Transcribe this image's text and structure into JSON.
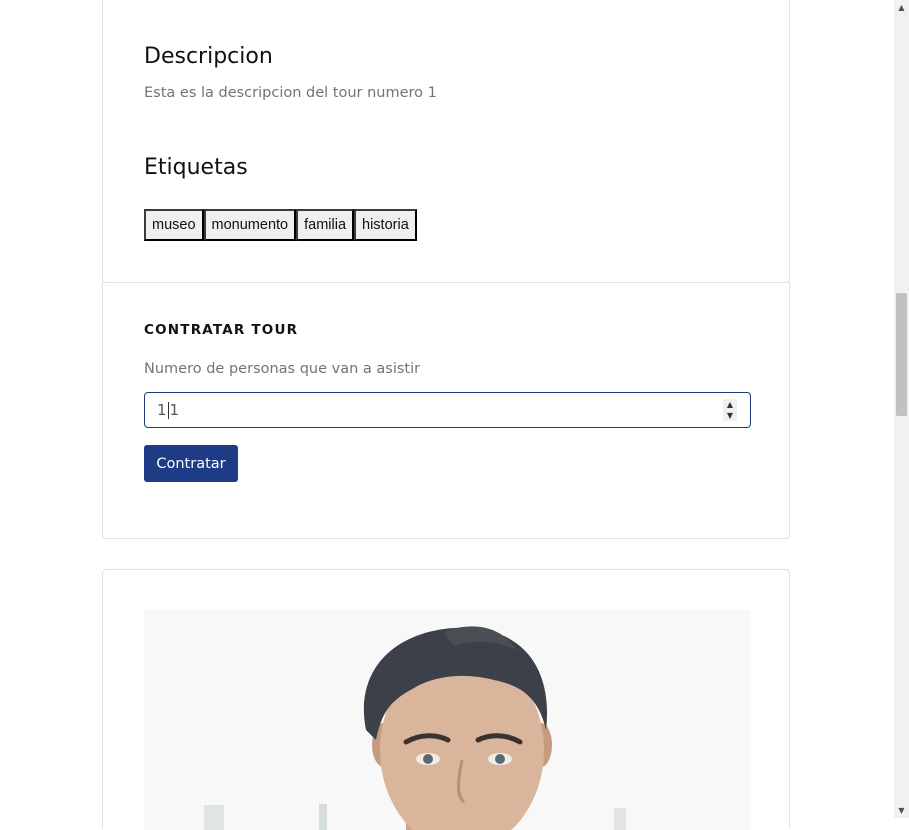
{
  "description": {
    "heading": "Descripcion",
    "text": "Esta es la descripcion del tour numero 1"
  },
  "tags": {
    "heading": "Etiquetas",
    "items": [
      "museo",
      "monumento",
      "familia",
      "historia"
    ]
  },
  "contract": {
    "title": "CONTRATAR TOUR",
    "people_label": "Numero de personas que van a asistir",
    "people_value_before_caret": "1",
    "people_value_after_caret": "1",
    "submit_label": "Contratar"
  },
  "photo": {
    "icon": "guide-portrait-photo"
  }
}
